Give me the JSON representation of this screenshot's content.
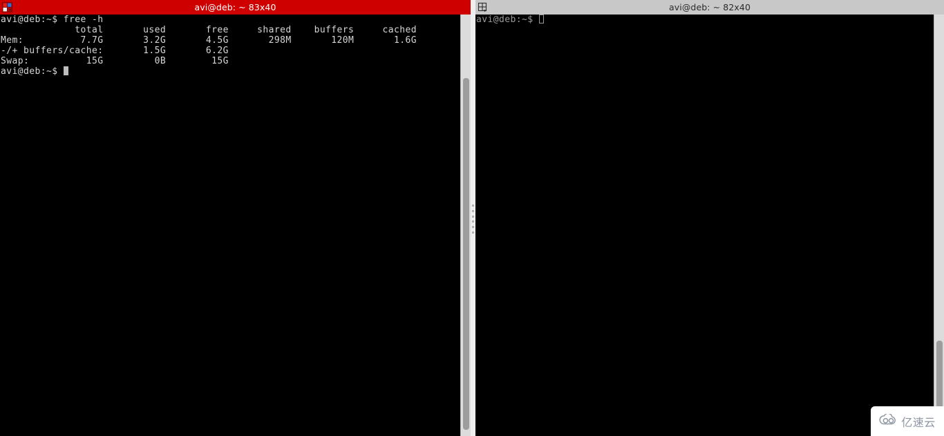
{
  "desktop": {
    "background_color": "#d9d9d9"
  },
  "windows": {
    "left": {
      "title": "avi@deb: ~ 83x40",
      "icon": "window-grid-icon",
      "state": "active",
      "titlebar_color": "#cf0000",
      "title_text_color": "#ffffff",
      "terminal": {
        "background_color": "#000000",
        "foreground_color": "#d6d6d6",
        "lines": [
          "avi@deb:~$ free -h",
          "             total       used       free     shared    buffers     cached",
          "Mem:          7.7G       3.2G       4.5G       298M       120M       1.6G",
          "-/+ buffers/cache:       1.5G       6.2G",
          "Swap:          15G         0B        15G"
        ],
        "prompt": "avi@deb:~$ ",
        "cursor": "filled-block"
      },
      "scrollbar": {
        "name": "vertical-scrollbar",
        "trough_color": "#dcdcdc",
        "thumb_color": "#9d9d9d"
      }
    },
    "right": {
      "title": "avi@deb: ~ 82x40",
      "icon": "window-grid-dropdown-icon",
      "state": "inactive",
      "titlebar_color": "#c8c8c8",
      "title_text_color": "#2b2b2b",
      "terminal": {
        "background_color": "#000000",
        "foreground_color": "#9a9a9a",
        "lines": [],
        "prompt": "avi@deb:~$ ",
        "cursor": "hollow-block"
      },
      "scrollbar": {
        "name": "vertical-scrollbar",
        "trough_color": "#dcdcdc",
        "thumb_color": "#9d9d9d"
      }
    }
  },
  "splitter": {
    "name": "window-splitter",
    "color": "#efefef"
  },
  "watermark": {
    "text": "亿速云",
    "icon": "cloud-icon",
    "color": "#8e96a3",
    "background": "#ffffff"
  },
  "terminal_table": {
    "headers": [
      "",
      "total",
      "used",
      "free",
      "shared",
      "buffers",
      "cached"
    ],
    "rows": [
      [
        "Mem:",
        "7.7G",
        "3.2G",
        "4.5G",
        "298M",
        "120M",
        "1.6G"
      ],
      [
        "-/+ buffers/cache:",
        "",
        "1.5G",
        "6.2G",
        "",
        "",
        ""
      ],
      [
        "Swap:",
        "15G",
        "0B",
        "15G",
        "",
        "",
        ""
      ]
    ],
    "command": "free -h"
  }
}
